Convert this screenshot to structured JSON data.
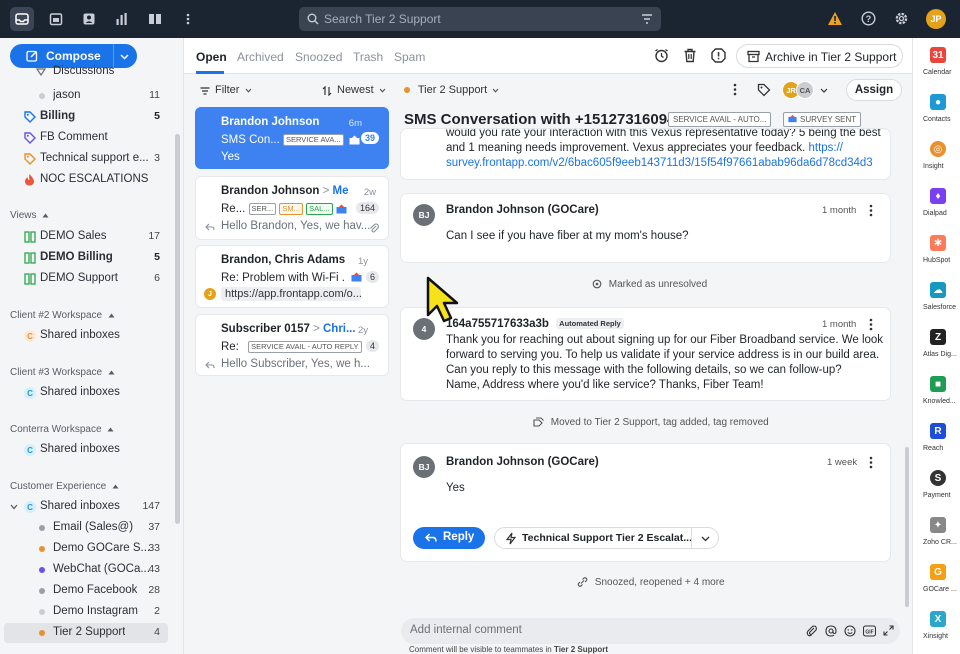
{
  "topbar": {
    "search_placeholder": "Search Tier 2 Support",
    "avatar_initials": "JP"
  },
  "sidebar": {
    "compose_label": "Compose",
    "items_top": [
      {
        "label": "Discussions"
      },
      {
        "label": "jason",
        "count": "11"
      },
      {
        "label": "Billing",
        "count": "5"
      },
      {
        "label": "FB Comment"
      },
      {
        "label": "Technical support e...",
        "count": "3"
      },
      {
        "label": "NOC ESCALATIONS"
      }
    ],
    "views_header": "Views",
    "views": [
      {
        "label": "DEMO Sales",
        "count": "17"
      },
      {
        "label": "DEMO Billing",
        "count": "5"
      },
      {
        "label": "DEMO Support",
        "count": "6"
      }
    ],
    "workspaces": [
      {
        "header": "Client #2 Workspace",
        "item": "Shared inboxes",
        "badge": "C"
      },
      {
        "header": "Client #3 Workspace",
        "item": "Shared inboxes",
        "badge": "C"
      },
      {
        "header": "Conterra Workspace",
        "item": "Shared inboxes",
        "badge": "C"
      }
    ],
    "customer_experience": {
      "header": "Customer Experience",
      "shared_label": "Shared inboxes",
      "shared_count": "147",
      "badge": "C",
      "inboxes": [
        {
          "label": "Email (Sales@)",
          "count": "37",
          "color": "#9aa0a8"
        },
        {
          "label": "Demo GOCare S...",
          "count": "33",
          "color": "#e8912d"
        },
        {
          "label": "WebChat (GOCa...",
          "count": "43",
          "color": "#6a4ff0"
        },
        {
          "label": "Demo Facebook",
          "count": "28",
          "color": "#9aa0a8"
        },
        {
          "label": "Demo Instagram",
          "count": "2",
          "color": "#c9ccd1"
        },
        {
          "label": "Tier 2 Support",
          "count": "4",
          "color": "#e8912d"
        }
      ]
    }
  },
  "tabs": {
    "items": [
      "Open",
      "Archived",
      "Snoozed",
      "Trash",
      "Spam"
    ],
    "archive_label": "Archive in Tier 2 Support"
  },
  "list": {
    "filter_label": "Filter",
    "sort_label": "Newest",
    "conversations": [
      {
        "name": "Brandon Johnson",
        "time": "6m",
        "subject": "SMS Con...",
        "tag": "SERVICE AVA...",
        "count": "39",
        "preview": "Yes"
      },
      {
        "name": "Brandon Johnson",
        "to": "Me",
        "time": "2w",
        "subject": "Re...",
        "tags": [
          "SER...",
          "SM...",
          "SAL..."
        ],
        "count": "164",
        "preview": "Hello Brandon, Yes, we hav..."
      },
      {
        "name": "Brandon, Chris Adams",
        "time": "1y",
        "subject": "Re: Problem with Wi-Fi ...",
        "count": "6",
        "preview": "https://app.frontapp.com/o...",
        "avatar": "J"
      },
      {
        "name": "Subscriber 0157",
        "to": "Chri...",
        "time": "2y",
        "subject": "Re:",
        "tag": "SERVICE AVAIL - AUTO REPLY",
        "count": "4",
        "preview": "Hello Subscriber, Yes, we h..."
      }
    ]
  },
  "conversation": {
    "inbox_label": "Tier 2 Support",
    "assign_label": "Assign",
    "assignees": [
      "JR",
      "CA"
    ],
    "title": "SMS Conversation with +15127316094",
    "tags": [
      "SERVICE AVAIL - AUTO...",
      "SURVEY SENT"
    ],
    "top_message": {
      "line1": "would you rate your interaction with this Vexus representative today? 5 being the best",
      "line2": "and 1 meaning needs improvement.  Vexus appreciates your feedback.",
      "link_prefix": "https://",
      "link_line": "survey.frontapp.com/v2/6bac605f9eeb143711d3/15f54f97661abab96da6d78cd34d3"
    },
    "message1": {
      "avatar": "BJ",
      "name": "Brandon Johnson (GOCare)",
      "time": "1 month",
      "body": "Can I see if you have fiber at my mom's house?"
    },
    "event1": "Marked as unresolved",
    "message2": {
      "avatar": "4",
      "name": "164a755717633a3b",
      "badge": "Automated Reply",
      "time": "1 month",
      "lines": [
        "Thank you for reaching out about signing up for our Fiber Broadband service.  We look",
        "forward to serving you.  To help us validate if your service address is in our build area.",
        "Can you reply to this message with the following details, so we can follow-up?",
        "Name, Address where you'd like service? Thanks, Fiber Team!"
      ]
    },
    "event2": "Moved to Tier 2 Support, tag added, tag removed",
    "message3": {
      "avatar": "BJ",
      "name": "Brandon Johnson (GOCare)",
      "time": "1 week",
      "body": "Yes"
    },
    "reply_label": "Reply",
    "macro_label": "Technical Support Tier 2 Escalat...",
    "event3": "Snoozed, reopened + 4 more",
    "comment_placeholder": "Add internal comment",
    "comment_hint_prefix": "Comment will be visible to teammates in ",
    "comment_hint_inbox": "Tier 2 Support"
  },
  "apps": [
    {
      "label": "Calendar",
      "icon": "31",
      "color": "#e8453c"
    },
    {
      "label": "Contacts",
      "icon": "●",
      "color": "#1c9ad6"
    },
    {
      "label": "Insight",
      "icon": "◎",
      "color": "#e8912d"
    },
    {
      "label": "Dialpad",
      "icon": "♦",
      "color": "#7a3ff0"
    },
    {
      "label": "HubSpot",
      "icon": "✱",
      "color": "#ff7a59"
    },
    {
      "label": "Salesforce",
      "icon": "☁",
      "color": "#1798c1"
    },
    {
      "label": "Atlas Dig...",
      "icon": "Z",
      "color": "#222222"
    },
    {
      "label": "Knowled...",
      "icon": "■",
      "color": "#1f9d55"
    },
    {
      "label": "Reach",
      "icon": "R",
      "color": "#1d4fd6"
    },
    {
      "label": "Payment",
      "icon": "S",
      "color": "#333333"
    },
    {
      "label": "Zoho CR...",
      "icon": "✦",
      "color": "#888888"
    },
    {
      "label": "GOCare ...",
      "icon": "G",
      "color": "#f4a012"
    },
    {
      "label": "Xinsight",
      "icon": "X",
      "color": "#2aa7c9"
    }
  ]
}
